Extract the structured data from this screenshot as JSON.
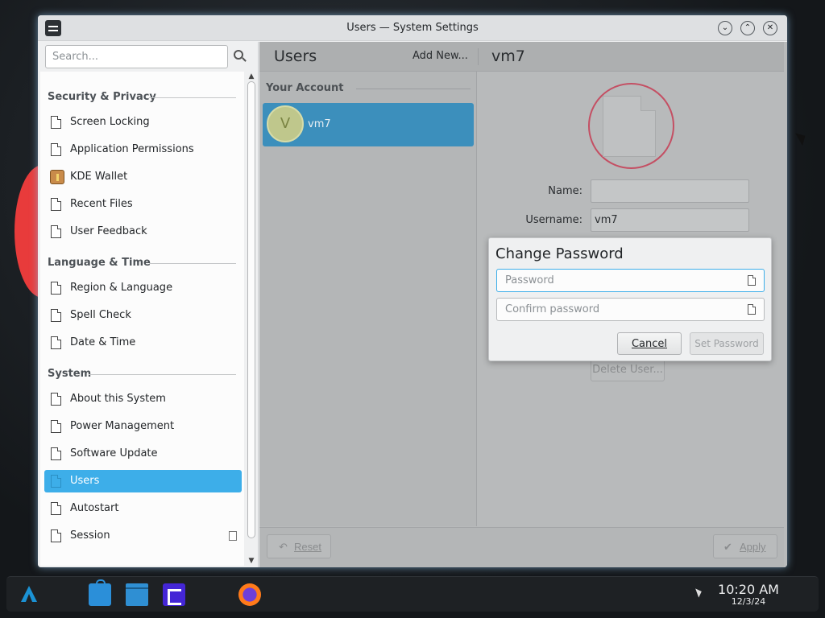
{
  "window": {
    "title": "Users — System Settings",
    "controls": {
      "minimize": "⌄",
      "maximize": "⌃",
      "close": "✕"
    }
  },
  "sidebar": {
    "search_placeholder": "Search...",
    "categories": {
      "security": "Security & Privacy",
      "language": "Language & Time",
      "system": "System"
    },
    "items": [
      {
        "label": "Screen Locking",
        "icon": "document-icon"
      },
      {
        "label": "Application Permissions",
        "icon": "document-icon"
      },
      {
        "label": "KDE Wallet",
        "icon": "wallet-icon"
      },
      {
        "label": "Recent Files",
        "icon": "document-icon"
      },
      {
        "label": "User Feedback",
        "icon": "document-icon"
      },
      {
        "label": "Region & Language",
        "icon": "document-icon"
      },
      {
        "label": "Spell Check",
        "icon": "document-icon"
      },
      {
        "label": "Date & Time",
        "icon": "document-icon"
      },
      {
        "label": "About this System",
        "icon": "document-icon"
      },
      {
        "label": "Power Management",
        "icon": "document-icon"
      },
      {
        "label": "Software Update",
        "icon": "document-icon"
      },
      {
        "label": "Users",
        "icon": "document-icon",
        "active": true
      },
      {
        "label": "Autostart",
        "icon": "document-icon"
      },
      {
        "label": "Session",
        "icon": "document-icon"
      }
    ]
  },
  "users_page": {
    "title": "Users",
    "add_new": "Add New...",
    "your_account": "Your Account",
    "current_user": {
      "avatar_initial": "V",
      "name": "vm7"
    },
    "detail_title": "vm7",
    "name_label": "Name:",
    "name_value": "",
    "username_label": "Username:",
    "username_value": "vm7",
    "delete_button": "Delete User...",
    "reset_button": "Reset",
    "apply_button": "Apply"
  },
  "dialog": {
    "title": "Change Password",
    "password_placeholder": "Password",
    "confirm_placeholder": "Confirm password",
    "cancel": "Cancel",
    "set_password": "Set Password"
  },
  "taskbar": {
    "time": "10:20 AM",
    "date": "12/3/24"
  },
  "colors": {
    "accent": "#3daee9",
    "selected_row": "#3c8fbc",
    "avatar_ring": "#c44f63"
  }
}
